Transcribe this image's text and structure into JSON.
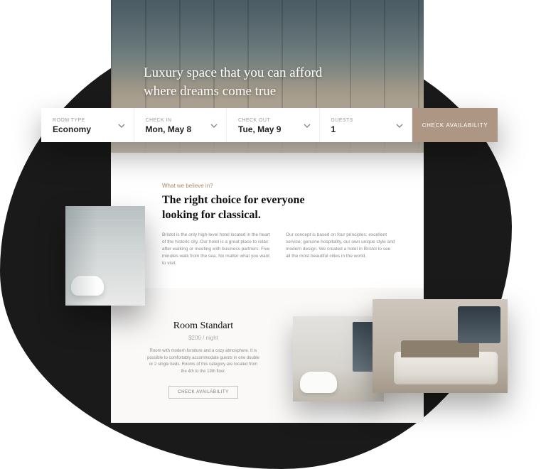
{
  "hero": {
    "title_line1": "Luxury space that you can afford",
    "title_line2": "where dreams come true"
  },
  "booking": {
    "fields": [
      {
        "label": "ROOM TYPE",
        "value": "Economy"
      },
      {
        "label": "CHECK IN",
        "value": "Mon, May 8"
      },
      {
        "label": "CHECK OUT",
        "value": "Tue, May 9"
      },
      {
        "label": "GUESTS",
        "value": "1"
      }
    ],
    "cta": "CHECK AVAILABILITY"
  },
  "about": {
    "kicker": "What we believe in?",
    "heading": "The right choice for everyone looking for classical.",
    "col1": "Bristol is the only high-level hotel located in the heart of the historic city. Our hotel is a great place to relax after walking or meeting with business partners. Five minutes walk from the sea. No matter what you want to visit.",
    "col2": "Our concept is based on four principles: excellent service, genuine hospitality, our own unique style and modern design. We created a hotel in Bristol to see all the most beautiful cities in the world."
  },
  "room": {
    "title": "Room Standart",
    "price": "$200 / night",
    "desc": "Room with modern furniture and a cozy atmosphere. It is possible to comfortably accommodate guests in one double or 2 single beds. Rooms of this category are located from the 4th to the 19th floor.",
    "cta": "CHECK AVAILABILITY"
  }
}
